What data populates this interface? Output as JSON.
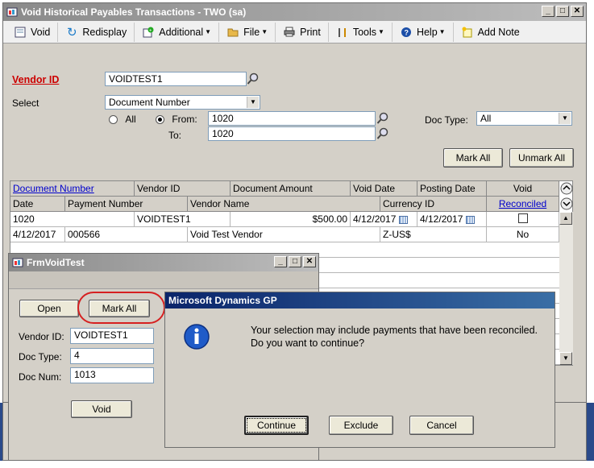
{
  "main_window": {
    "title": "Void Historical Payables Transactions  -  TWO (sa)",
    "toolbar": [
      {
        "label": "Void",
        "icon": "void-icon"
      },
      {
        "label": "Redisplay",
        "icon": "redisplay-icon"
      },
      {
        "label": "Additional",
        "icon": "additional-icon",
        "dropdown": true
      },
      {
        "label": "File",
        "icon": "file-icon",
        "dropdown": true
      },
      {
        "label": "Print",
        "icon": "print-icon"
      },
      {
        "label": "Tools",
        "icon": "tools-icon",
        "dropdown": true
      },
      {
        "label": "Help",
        "icon": "help-icon",
        "dropdown": true
      },
      {
        "label": "Add Note",
        "icon": "add-note-icon"
      }
    ],
    "vendor_id_label": "Vendor ID",
    "vendor_id_value": "VOIDTEST1",
    "select_label": "Select",
    "select_value": "Document Number",
    "all_label": "All",
    "from_label": "From:",
    "from_value": "1020",
    "to_label": "To:",
    "to_value": "1020",
    "doc_type_label": "Doc Type:",
    "doc_type_value": "All",
    "mark_all_label": "Mark All",
    "unmark_all_label": "Unmark All",
    "grid": {
      "header1": [
        "Document Number",
        "Vendor ID",
        "Document Amount",
        "Void Date",
        "Posting Date",
        "Void"
      ],
      "header2": [
        "Date",
        "Payment Number",
        "Vendor Name",
        "Currency ID",
        "Reconciled"
      ],
      "row1": {
        "doc": "1020",
        "vendor": "VOIDTEST1",
        "amount": "$500.00",
        "void_date": "4/12/2017",
        "posting_date": "4/12/2017"
      },
      "row2": {
        "date": "4/12/2017",
        "payment": "000566",
        "vendor_name": "Void Test Vendor",
        "currency": "Z-US$",
        "reconciled": "No"
      }
    }
  },
  "test_window": {
    "title": "FrmVoidTest",
    "open_label": "Open",
    "mark_all_label": "Mark All",
    "vendor_id_label": "Vendor ID:",
    "vendor_id_value": "VOIDTEST1",
    "doc_type_label": "Doc Type:",
    "doc_type_value": "4",
    "doc_num_label": "Doc Num:",
    "doc_num_value": "1013",
    "void_label": "Void"
  },
  "dialog": {
    "title": "Microsoft Dynamics GP",
    "message_line1": "Your selection may include payments that have been reconciled.",
    "message_line2": "Do you want to continue?",
    "continue_label": "Continue",
    "exclude_label": "Exclude",
    "cancel_label": "Cancel"
  },
  "colors": {
    "accent_red": "#cc0000",
    "link_blue": "#0000cc",
    "title_active": "#0a246a"
  }
}
